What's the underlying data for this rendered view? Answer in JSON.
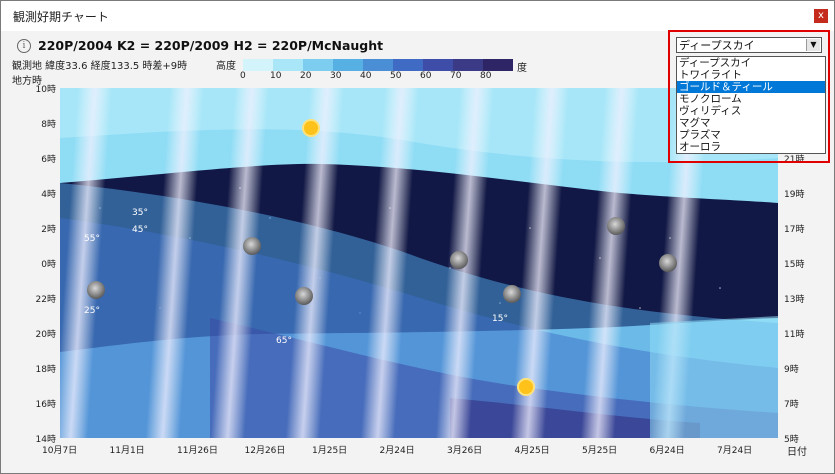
{
  "window": {
    "title": "観測好期チャート",
    "close_label": "x"
  },
  "header": {
    "info_glyph": "i",
    "comet_names": "220P/2004  K2 = 220P/2009  H2 = 220P/McNaught",
    "observer_info": "観測地 緯度33.6 経度133.5 時差+9時",
    "altitude_label": "高度",
    "altitude_unit": "度"
  },
  "legend": {
    "colors": [
      "#d4f4fc",
      "#a9e6f7",
      "#7ccdef",
      "#56b0e3",
      "#4a8fd6",
      "#3f6bc4",
      "#3e4ea8",
      "#3a3a86",
      "#2e2566"
    ],
    "ticks": [
      "0",
      "10",
      "20",
      "30",
      "40",
      "50",
      "60",
      "70",
      "80"
    ]
  },
  "dropdown": {
    "selected": "ディープスカイ",
    "options": [
      "ディープスカイ",
      "トワイライト",
      "ゴールド＆ティール",
      "モノクローム",
      "ヴィリディス",
      "マグマ",
      "プラズマ",
      "オーロラ"
    ],
    "highlighted_index": 2
  },
  "chart_data": {
    "type": "heatmap",
    "xlabel": "日付",
    "ylabel": "地方時",
    "x_ticks": [
      "10月7日",
      "11月1日",
      "11月26日",
      "12月26日",
      "1月25日",
      "2月24日",
      "3月26日",
      "4月25日",
      "5月25日",
      "6月24日",
      "7月24日"
    ],
    "y_ticks_left": [
      "10時",
      "8時",
      "6時",
      "4時",
      "2時",
      "0時",
      "22時",
      "20時",
      "18時",
      "16時",
      "14時"
    ],
    "y_ticks_right": [
      "21時",
      "19時",
      "17時",
      "15時",
      "13時",
      "11時",
      "9時",
      "7時",
      "5時"
    ],
    "altitude_labels": [
      "35°",
      "45°",
      "55°",
      "25°",
      "65°",
      "15°"
    ],
    "moon_count": 9,
    "sun_count": 2
  }
}
